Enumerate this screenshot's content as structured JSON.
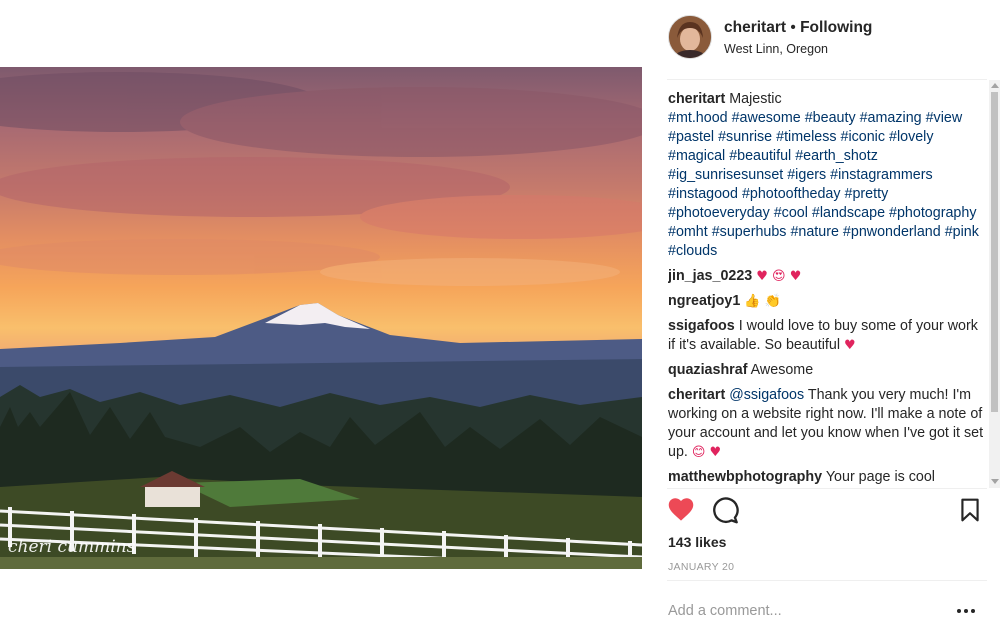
{
  "post": {
    "username": "cheritart",
    "separator": " • ",
    "follow_status": "Following",
    "location": "West Linn, Oregon"
  },
  "photo": {
    "signature": "cheri cummins"
  },
  "caption": {
    "username": "cheritart",
    "text": "Majestic",
    "hashtags": [
      "#mt.hood",
      "#awesome",
      "#beauty",
      "#amazing",
      "#view",
      "#pastel",
      "#sunrise",
      "#timeless",
      "#iconic",
      "#lovely",
      "#magical",
      "#beautiful",
      "#earth_shotz",
      "#ig_sunrisesunset",
      "#igers",
      "#instagrammers",
      "#instagood",
      "#photooftheday",
      "#pretty",
      "#photoeveryday",
      "#cool",
      "#landscape",
      "#photography",
      "#omht",
      "#superhubs",
      "#nature",
      "#pnwonderland",
      "#pink",
      "#clouds"
    ]
  },
  "comments": [
    {
      "username": "jin_jas_0223",
      "text": "",
      "emoji": "♥ 😍 ♥"
    },
    {
      "username": "ngreatjoy1",
      "text": "",
      "emoji": "👍 👏"
    },
    {
      "username": "ssigafoos",
      "text": "I would love to buy some of your work if it's available. So beautiful",
      "emoji": "♥"
    },
    {
      "username": "quaziashraf",
      "text": "Awesome",
      "emoji": ""
    },
    {
      "username": "cheritart",
      "mention": "@ssigafoos",
      "text": "Thank you very much! I'm working on a website right now. I'll make a note of your account and let you know when I've got it set up.",
      "emoji": "😊 ♥"
    },
    {
      "username": "matthewbphotography",
      "text": "Your page is cool",
      "emoji": ""
    }
  ],
  "likes": {
    "count": "143",
    "label": "likes"
  },
  "date": "JANUARY 20",
  "add_comment": {
    "placeholder": "Add a comment..."
  },
  "icons": {
    "like": "heart-icon",
    "comment": "comment-icon",
    "save": "bookmark-icon",
    "more": "more-icon"
  },
  "colors": {
    "like": "#ed4956",
    "hashtag": "#003569",
    "muted": "#999999"
  }
}
